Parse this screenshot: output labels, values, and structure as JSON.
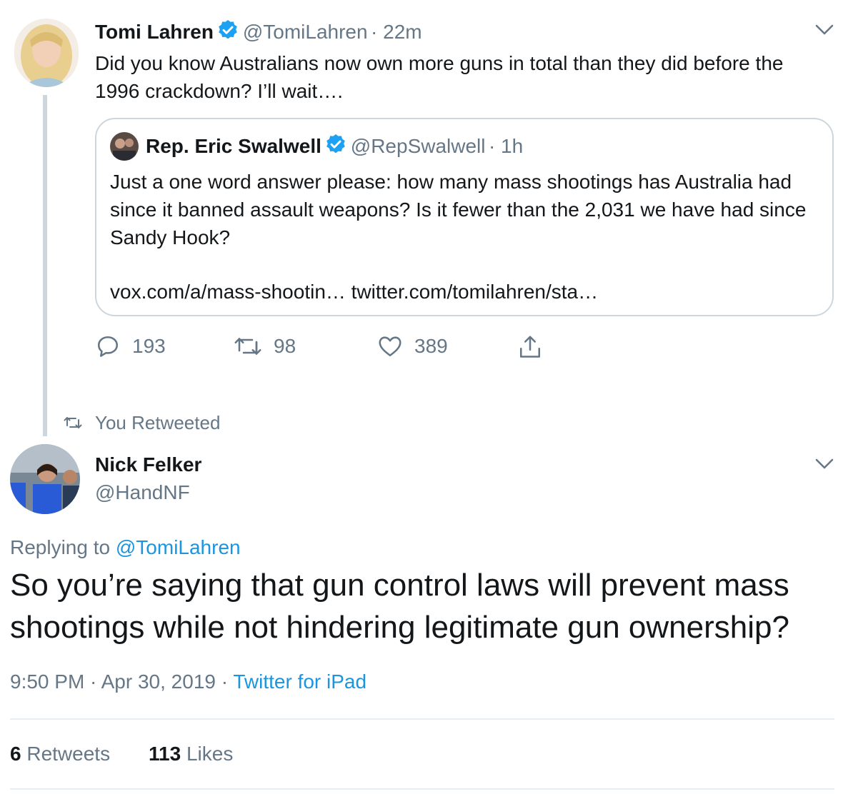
{
  "parent_tweet": {
    "author_name": "Tomi Lahren",
    "handle": "@TomiLahren",
    "time": "· 22m",
    "text": "Did you know Australians now own more guns in total than they did before the 1996 crackdown? I’ll wait….",
    "quoted": {
      "author_name": "Rep. Eric Swalwell",
      "handle": "@RepSwalwell",
      "time": "· 1h",
      "text": "Just a one word answer please: how many mass shootings has Australia had since it banned assault weapons? Is it fewer than the 2,031 we have had since Sandy Hook?",
      "links": "vox.com/a/mass-shootin… twitter.com/tomilahren/sta…"
    },
    "actions": {
      "replies": "193",
      "retweets": "98",
      "likes": "389"
    }
  },
  "retweet_indicator": "You Retweeted",
  "main_tweet": {
    "author_name": "Nick Felker",
    "handle": "@HandNF",
    "replying_prefix": "Replying to",
    "replying_to": "@TomiLahren",
    "text": "So you’re saying that gun control laws will prevent mass shootings while not hindering legitimate gun ownership?",
    "timestamp": "9:50 PM · Apr 30, 2019 · ",
    "source": "Twitter for iPad",
    "retweet_count": "6",
    "retweet_label": "Retweets",
    "like_count": "113",
    "like_label": "Likes"
  },
  "colors": {
    "link": "#1b95e0",
    "muted": "#657786",
    "verified": "#1da1f2",
    "border": "#ccd6dd"
  },
  "icons": [
    "verified-badge-icon",
    "chevron-down-icon",
    "reply-icon",
    "retweet-icon",
    "like-icon",
    "share-icon"
  ]
}
